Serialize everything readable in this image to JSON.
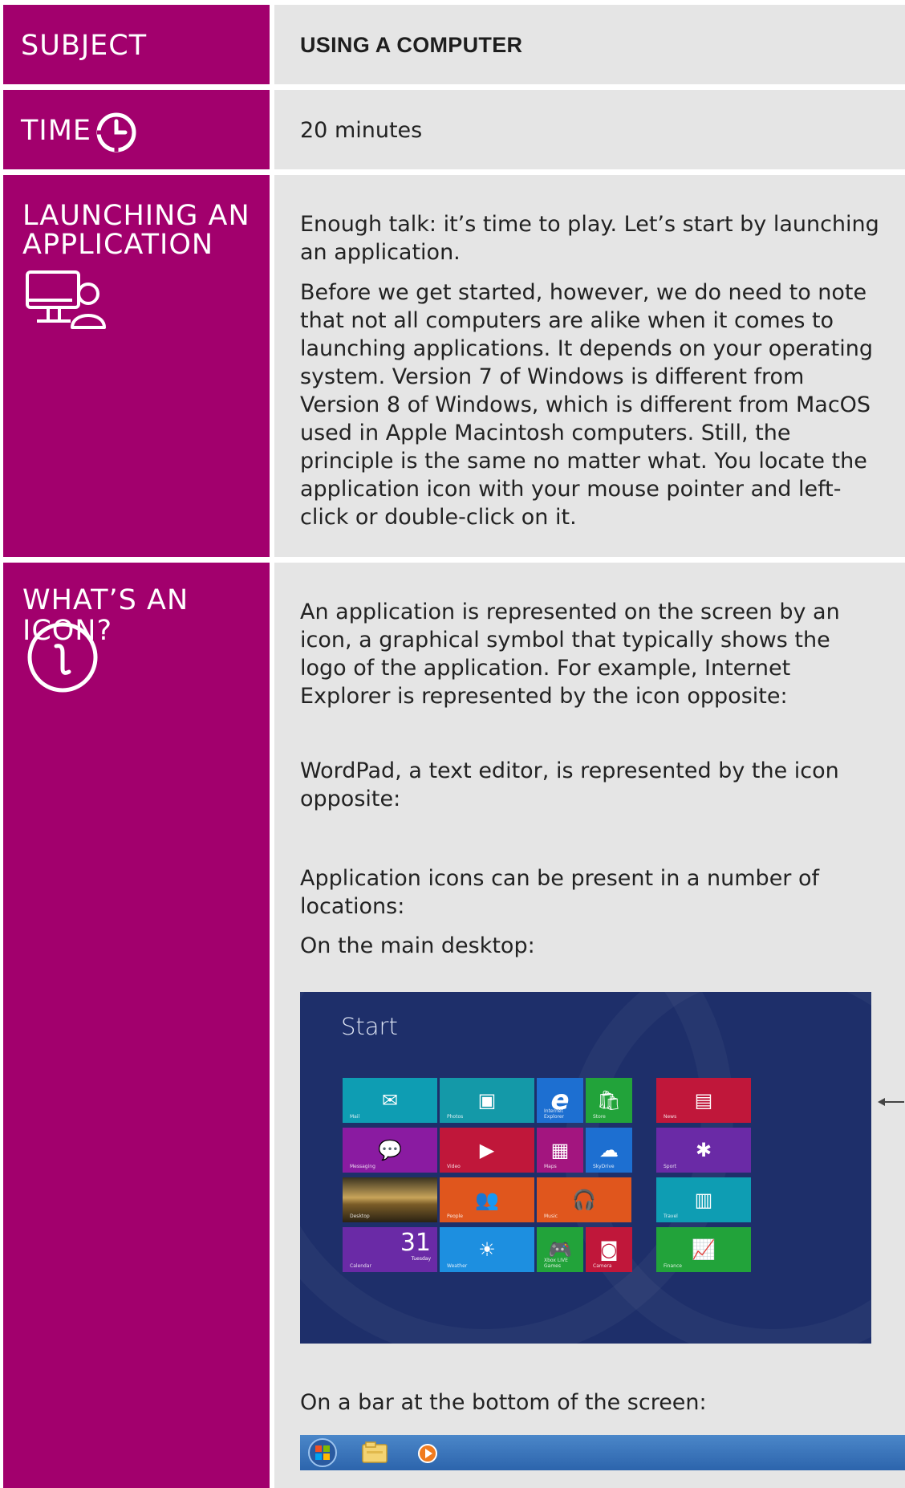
{
  "rows": {
    "subject": {
      "label": "SUBJECT",
      "value": "USING A COMPUTER"
    },
    "time": {
      "label": "TIME",
      "value": "20 minutes"
    },
    "launching": {
      "label_line1": "LAUNCHING AN",
      "label_line2": "APPLICATION",
      "paragraphs": [
        "Enough talk: it’s time to play. Let’s start by launching an application.",
        "Before we get started, however, we do need to note that not all computers are alike when it comes to launching applications. It depends on your operating system. Version 7 of Windows is different from Version 8 of Windows, which is different from MacOS used in Apple Macintosh computers. Still, the principle is the same no matter what. You locate the application icon with your mouse pointer and left-click or double-click on it."
      ]
    },
    "icon_section": {
      "label": "WHAT’S AN ICON?",
      "para_ie": "An application is represented on the screen by an icon, a graphical symbol that typically shows the logo of the application. For example, Internet Explorer is represented by the icon opposite:",
      "para_wordpad": "WordPad, a text editor, is represented by the icon opposite:",
      "para_locations": "Application icons can be present in a number of locations:",
      "para_desktop": "On the main desktop:",
      "para_bar": "On a bar at the bottom of the screen:"
    }
  },
  "start_screen": {
    "title": "Start",
    "tiles": [
      {
        "label": "Mail",
        "icon": "mail-icon",
        "color": "#0e9db3"
      },
      {
        "label": "Photos",
        "icon": "photos-icon",
        "color": "#1499a8"
      },
      {
        "label": "Internet Explorer",
        "icon": "ie-icon",
        "color": "#1d6fd1"
      },
      {
        "label": "Store",
        "icon": "store-icon",
        "color": "#22a33a"
      },
      {
        "label": "News",
        "icon": "news-icon",
        "color": "#c0173a"
      },
      {
        "label": "Messaging",
        "icon": "messaging-icon",
        "color": "#8a1ba1"
      },
      {
        "label": "Video",
        "icon": "video-icon",
        "color": "#c0173a"
      },
      {
        "label": "Maps",
        "icon": "maps-icon",
        "color": "#a3157f"
      },
      {
        "label": "SkyDrive",
        "icon": "skydrive-icon",
        "color": "#1d6fd1"
      },
      {
        "label": "Sport",
        "icon": "sport-icon",
        "color": "#6a2aa6"
      },
      {
        "label": "Desktop",
        "icon": "desktop-photo",
        "color": "#8b6b32"
      },
      {
        "label": "People",
        "icon": "people-icon",
        "color": "#e0561d"
      },
      {
        "label": "Music",
        "icon": "music-icon",
        "color": "#e0561d"
      },
      {
        "label": "Travel",
        "icon": "travel-icon",
        "color": "#0e9db3"
      },
      {
        "label": "Calendar",
        "date": "31",
        "day": "Tuesday",
        "icon": "calendar-icon",
        "color": "#6a2aa6"
      },
      {
        "label": "Weather",
        "icon": "weather-icon",
        "color": "#1d8fe0"
      },
      {
        "label": "Xbox LIVE Games",
        "icon": "xbox-icon",
        "color": "#22a33a"
      },
      {
        "label": "Camera",
        "icon": "camera-icon",
        "color": "#c0173a"
      },
      {
        "label": "Finance",
        "icon": "finance-icon",
        "color": "#22a33a"
      }
    ]
  },
  "taskbar": {
    "items": [
      {
        "icon": "start-orb-icon"
      },
      {
        "icon": "file-explorer-icon"
      },
      {
        "icon": "media-player-icon"
      }
    ]
  }
}
